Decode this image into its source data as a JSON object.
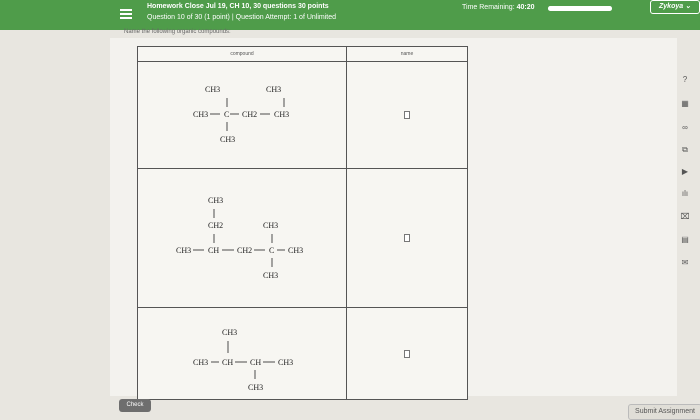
{
  "header": {
    "title": "Homework Close Jul 19, CH 10, 30 questions 30 points",
    "question_info": "Question 10 of 30 (1 point)",
    "separator": "|",
    "attempt_info": "Question Attempt: 1 of Unlimited",
    "timer_label": "Time Remaining:",
    "timer_value": "40:20",
    "timer_progress": 1.0,
    "user_name": "Zykoya"
  },
  "instruction": "Name the following organic compounds:",
  "table": {
    "headers": [
      "compound",
      "name"
    ],
    "rows": [
      {
        "labels": [
          "CH3",
          "CH3",
          "CH3",
          "C",
          "CH2",
          "CH3",
          "CH3"
        ],
        "answer": ""
      },
      {
        "labels": [
          "CH3",
          "CH2",
          "CH3",
          "CH3",
          "CH",
          "CH2",
          "C",
          "CH3",
          "CH3"
        ],
        "answer": ""
      },
      {
        "labels": [
          "CH3",
          "CH3",
          "CH",
          "CH",
          "CH3",
          "CH3"
        ],
        "answer": ""
      }
    ]
  },
  "sidebar_icons": [
    "help-icon",
    "calculator-icon",
    "periodic-table-icon",
    "book-icon",
    "video-icon",
    "data-icon",
    "drawing-icon",
    "grid-icon",
    "mail-icon"
  ],
  "sidebar_glyphs": [
    "?",
    "▦",
    "∞",
    "⧉",
    "▶",
    "ılı",
    "⌧",
    "▤",
    "✉"
  ],
  "buttons": {
    "check": "Check",
    "submit": "Submit Assignment"
  },
  "colors": {
    "header": "#4f9c4a",
    "check_button": "#6e6e6e"
  }
}
